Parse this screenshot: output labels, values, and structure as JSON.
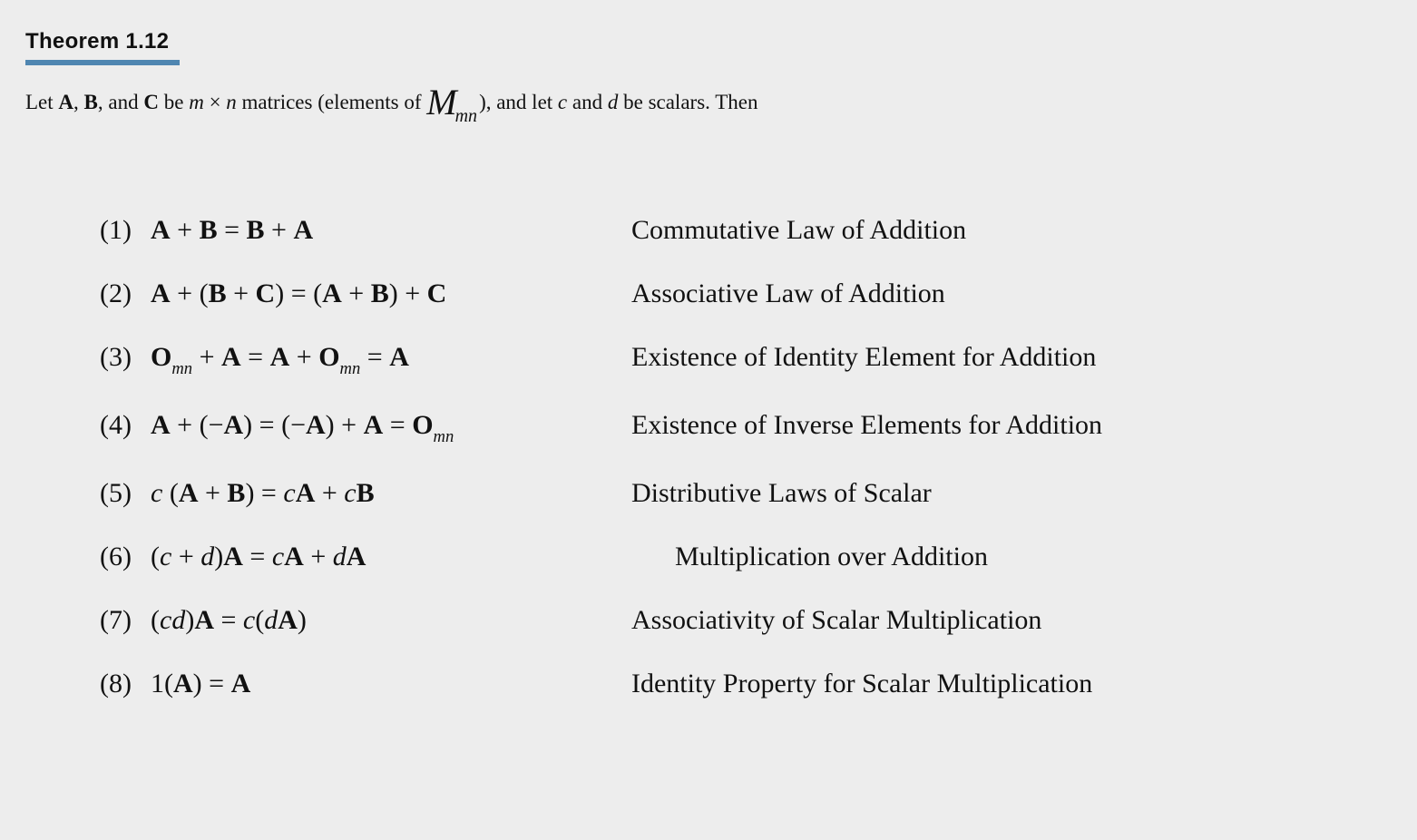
{
  "theorem": {
    "title": "Theorem 1.12"
  },
  "intro": {
    "p1": "Let ",
    "A": "A",
    "c1": ", ",
    "B": "B",
    "c2": ", and ",
    "C": "C",
    "p2": " be ",
    "m": "m",
    "times": " × ",
    "n": "n",
    "p3": " matrices (elements of ",
    "Mcap": "M",
    "Msub": "mn",
    "p4": "), and let ",
    "c": "c",
    "and": " and ",
    "d": "d",
    "p5": " be scalars. Then"
  },
  "items": {
    "1": {
      "num": "(1) ",
      "eq": {
        "t1": "A",
        "t2": " + ",
        "t3": "B",
        "t4": " = ",
        "t5": "B",
        "t6": " + ",
        "t7": "A"
      },
      "name": "Commutative Law of Addition"
    },
    "2": {
      "num": "(2) ",
      "eq": {
        "t1": "A",
        "t2": " + (",
        "t3": "B",
        "t4": " + ",
        "t5": "C",
        "t6": ") = (",
        "t7": "A",
        "t8": " + ",
        "t9": "B",
        "t10": ") + ",
        "t11": "C"
      },
      "name": "Associative Law of Addition"
    },
    "3": {
      "num": "(3) ",
      "eq": {
        "t1": "O",
        "s1": "mn",
        "t2": " + ",
        "t3": "A",
        "t4": " = ",
        "t5": "A",
        "t6": " + ",
        "t7": "O",
        "s2": "mn",
        "t8": " = ",
        "t9": "A"
      },
      "name": "Existence of Identity Element for Addition"
    },
    "4": {
      "num": "(4) ",
      "eq": {
        "t1": "A",
        "t2": " + (−",
        "t3": "A",
        "t4": ") = (−",
        "t5": "A",
        "t6": ") + ",
        "t7": "A",
        "t8": " = ",
        "t9": "O",
        "s1": "mn"
      },
      "name": "Existence of Inverse Elements for Addition"
    },
    "5": {
      "num": "(5) ",
      "eq": {
        "t1": "c",
        "t2": " (",
        "t3": "A",
        "t4": " + ",
        "t5": "B",
        "t6": ") = ",
        "t7": "c",
        "t8": "A",
        "t9": " + ",
        "t10": "c",
        "t11": "B"
      },
      "name": "Distributive Laws of Scalar"
    },
    "6": {
      "num": "(6) ",
      "eq": {
        "t1": "(",
        "t2": "c",
        "t3": " + ",
        "t4": "d",
        "t5": ")",
        "t6": "A",
        "t7": " = ",
        "t8": "c",
        "t9": "A",
        "t10": " + ",
        "t11": "d",
        "t12": "A"
      },
      "name": "Multiplication over Addition"
    },
    "7": {
      "num": "(7) ",
      "eq": {
        "t1": "(",
        "t2": "cd",
        "t3": ")",
        "t4": "A",
        "t5": " = ",
        "t6": "c",
        "t7": "(",
        "t8": "d",
        "t9": "A",
        "t10": ")"
      },
      "name": "Associativity of Scalar Multiplication"
    },
    "8": {
      "num": "(8) ",
      "eq": {
        "t1": "1(",
        "t2": "A",
        "t3": ") = ",
        "t4": "A"
      },
      "name": "Identity Property for Scalar Multiplication"
    }
  }
}
